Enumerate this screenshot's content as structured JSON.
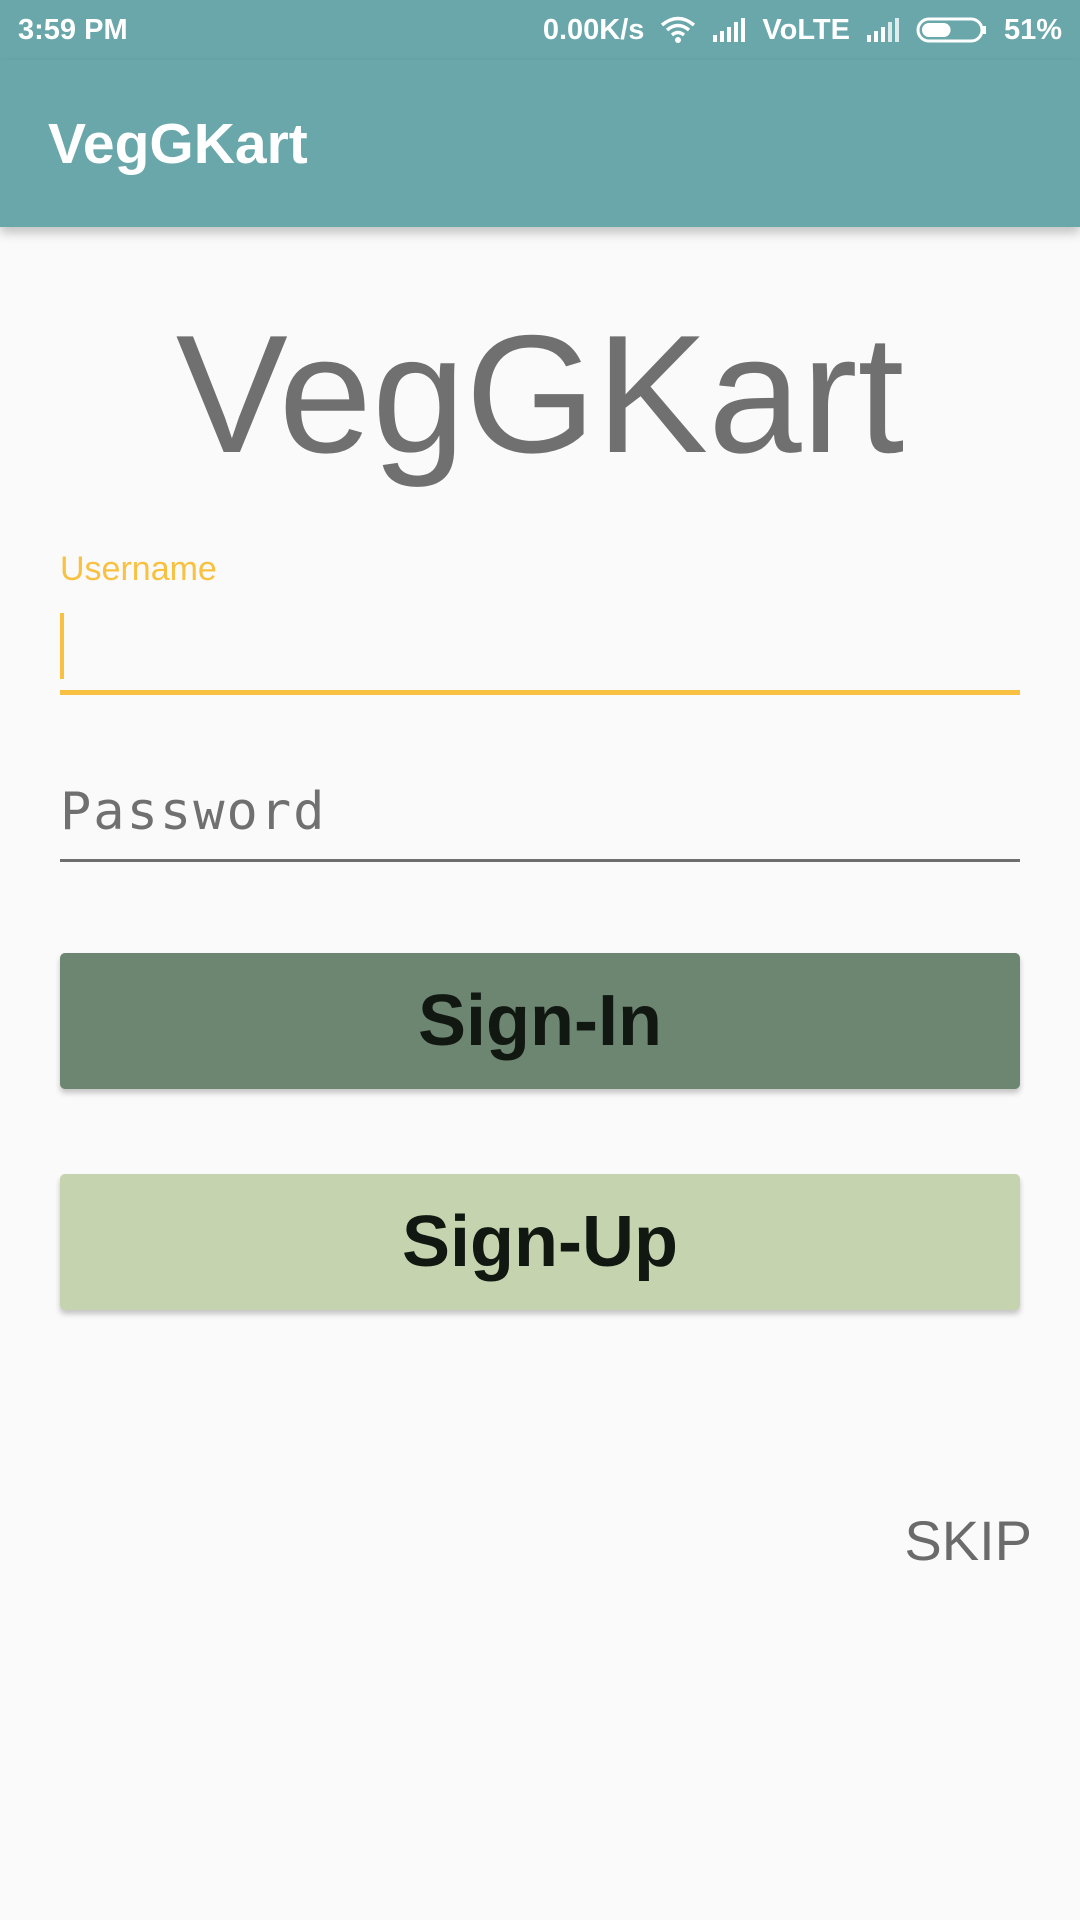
{
  "status_bar": {
    "time": "3:59 PM",
    "net_speed": "0.00K/s",
    "network_type": "VoLTE",
    "battery": "51%",
    "icons": [
      "wifi-icon",
      "signal-icon",
      "signal-icon",
      "battery-icon"
    ],
    "battery_level": 0.51
  },
  "app_bar": {
    "title": "VegGKart"
  },
  "main": {
    "logo_title": "VegGKart",
    "username": {
      "label": "Username",
      "value": ""
    },
    "password": {
      "placeholder": "Password",
      "value": ""
    },
    "signin_label": "Sign-In",
    "signup_label": "Sign-Up",
    "skip_label": "SKIP"
  },
  "colors": {
    "primary": "#69a7aa",
    "accent": "#f8c141",
    "signin_bg": "#6d8671",
    "signup_bg": "#c5d3ae",
    "background": "#fafafa"
  }
}
